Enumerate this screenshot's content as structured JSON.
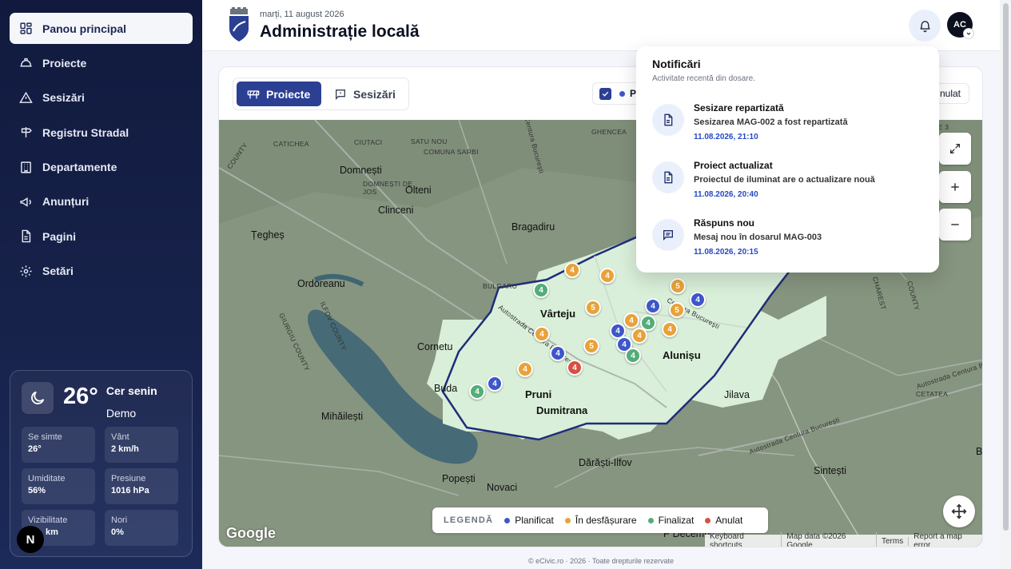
{
  "sidebar": {
    "items": [
      {
        "label": "Panou principal",
        "icon": "dashboard-icon"
      },
      {
        "label": "Proiecte",
        "icon": "hardhat-icon"
      },
      {
        "label": "Sesizări",
        "icon": "warning-icon"
      },
      {
        "label": "Registru Stradal",
        "icon": "signpost-icon"
      },
      {
        "label": "Departamente",
        "icon": "building-icon"
      },
      {
        "label": "Anunțuri",
        "icon": "megaphone-icon"
      },
      {
        "label": "Pagini",
        "icon": "document-icon"
      },
      {
        "label": "Setări",
        "icon": "gear-icon"
      }
    ],
    "weather": {
      "temp": "26°",
      "desc": "Cer senin",
      "location": "Demo",
      "stats": [
        {
          "label": "Se simte",
          "value": "26°"
        },
        {
          "label": "Vânt",
          "value": "2 km/h"
        },
        {
          "label": "Umiditate",
          "value": "56%"
        },
        {
          "label": "Presiune",
          "value": "1016 hPa"
        },
        {
          "label": "Vizibilitate",
          "value": "km"
        },
        {
          "label": "Nori",
          "value": "0%"
        }
      ]
    },
    "badge": "N"
  },
  "header": {
    "date": "marți, 11 august 2026",
    "title": "Administrație locală",
    "avatar": "AC"
  },
  "tabs": {
    "projects": "Proiecte",
    "reports": "Sesizări"
  },
  "filters": {
    "left_label": "P",
    "right_label": "nulat"
  },
  "map": {
    "places": [
      "Domnești",
      "Olteni",
      "Clinceni",
      "Bragadiru",
      "Țegheș",
      "Ordoreanu",
      "Vârteju",
      "Cornetu",
      "Alunișu",
      "Buda",
      "Pruni",
      "Dumitrana",
      "Mihăilești",
      "Jilava",
      "Dărăști-Ilfov",
      "Popești",
      "Novaci",
      "Sintești",
      "B",
      "P Decemb"
    ],
    "small_places": [
      "CATICHEA",
      "CIUTACI",
      "SATU NOU",
      "COMUNA SARBI",
      "GHENCEA",
      "DOMNEȘTI DE JOS",
      "BULGARU",
      "COUNTY",
      "ILFOV COUNTY",
      "GIURGIU COUNTY",
      "CHAREST",
      "COUNTY",
      "Autostrada Centura București",
      "Autostrada Centura București",
      "Șoseaua Centura București",
      "Centura București",
      "Autostrada Centura București",
      "CETATEA",
      "IE 3"
    ],
    "marker_numbers": [
      "4",
      "4",
      "4",
      "5",
      "4",
      "4",
      "5",
      "5",
      "4",
      "4",
      "4",
      "4",
      "4",
      "4",
      "5",
      "4",
      "4",
      "4",
      "4",
      "4",
      "4",
      "4"
    ],
    "legend_title": "LEGENDĂ",
    "legend": [
      {
        "label": "Planificat",
        "color": "#3d57c9"
      },
      {
        "label": "În desfășurare",
        "color": "#e8a23a"
      },
      {
        "label": "Finalizat",
        "color": "#53ad77"
      },
      {
        "label": "Anulat",
        "color": "#d84f42"
      }
    ],
    "google": "Google",
    "attribution": [
      "Keyboard shortcuts",
      "Map data ©2026 Google",
      "Terms",
      "Report a map error"
    ]
  },
  "notifications": {
    "title": "Notificări",
    "subtitle": "Activitate recentă din dosare.",
    "items": [
      {
        "title": "Sesizare repartizată",
        "message": "Sesizarea MAG-002 a fost repartizată",
        "date": "11.08.2026, 21:10",
        "icon": "document-icon"
      },
      {
        "title": "Proiect actualizat",
        "message": "Proiectul de iluminat are o actualizare nouă",
        "date": "11.08.2026, 20:40",
        "icon": "document-icon"
      },
      {
        "title": "Răspuns nou",
        "message": "Mesaj nou în dosarul MAG-003",
        "date": "11.08.2026, 20:15",
        "icon": "chat-icon"
      }
    ]
  },
  "footer": "© eCivic.ro · 2026 · Toate drepturile rezervate"
}
